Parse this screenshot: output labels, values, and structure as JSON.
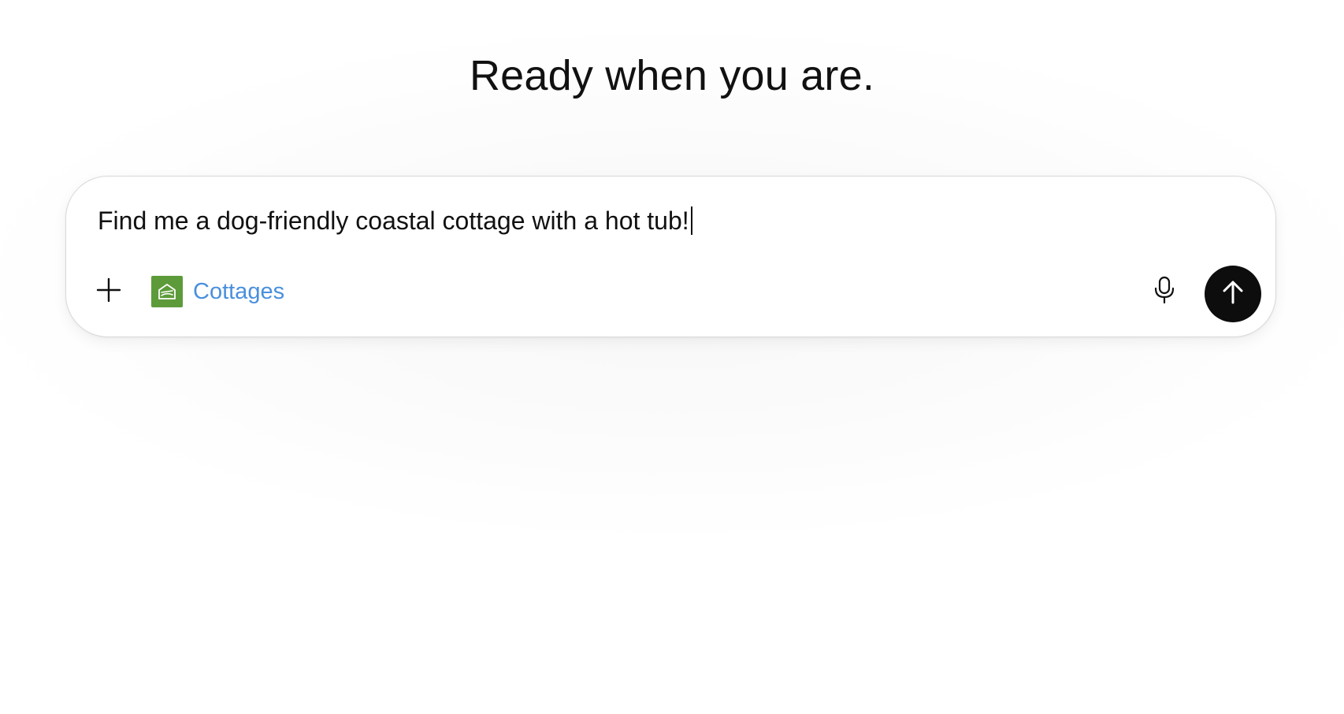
{
  "heading": "Ready when you are.",
  "composer": {
    "input_value": "Find me a dog-friendly coastal cottage with a hot tub!",
    "attach_icon": "plus-icon",
    "app": {
      "label": "Cottages",
      "icon": "cottage-logo-icon",
      "logo_color": "#5d9b3a",
      "label_color": "#4a8fdd"
    },
    "mic_icon": "microphone-icon",
    "send_icon": "arrow-up-icon"
  }
}
